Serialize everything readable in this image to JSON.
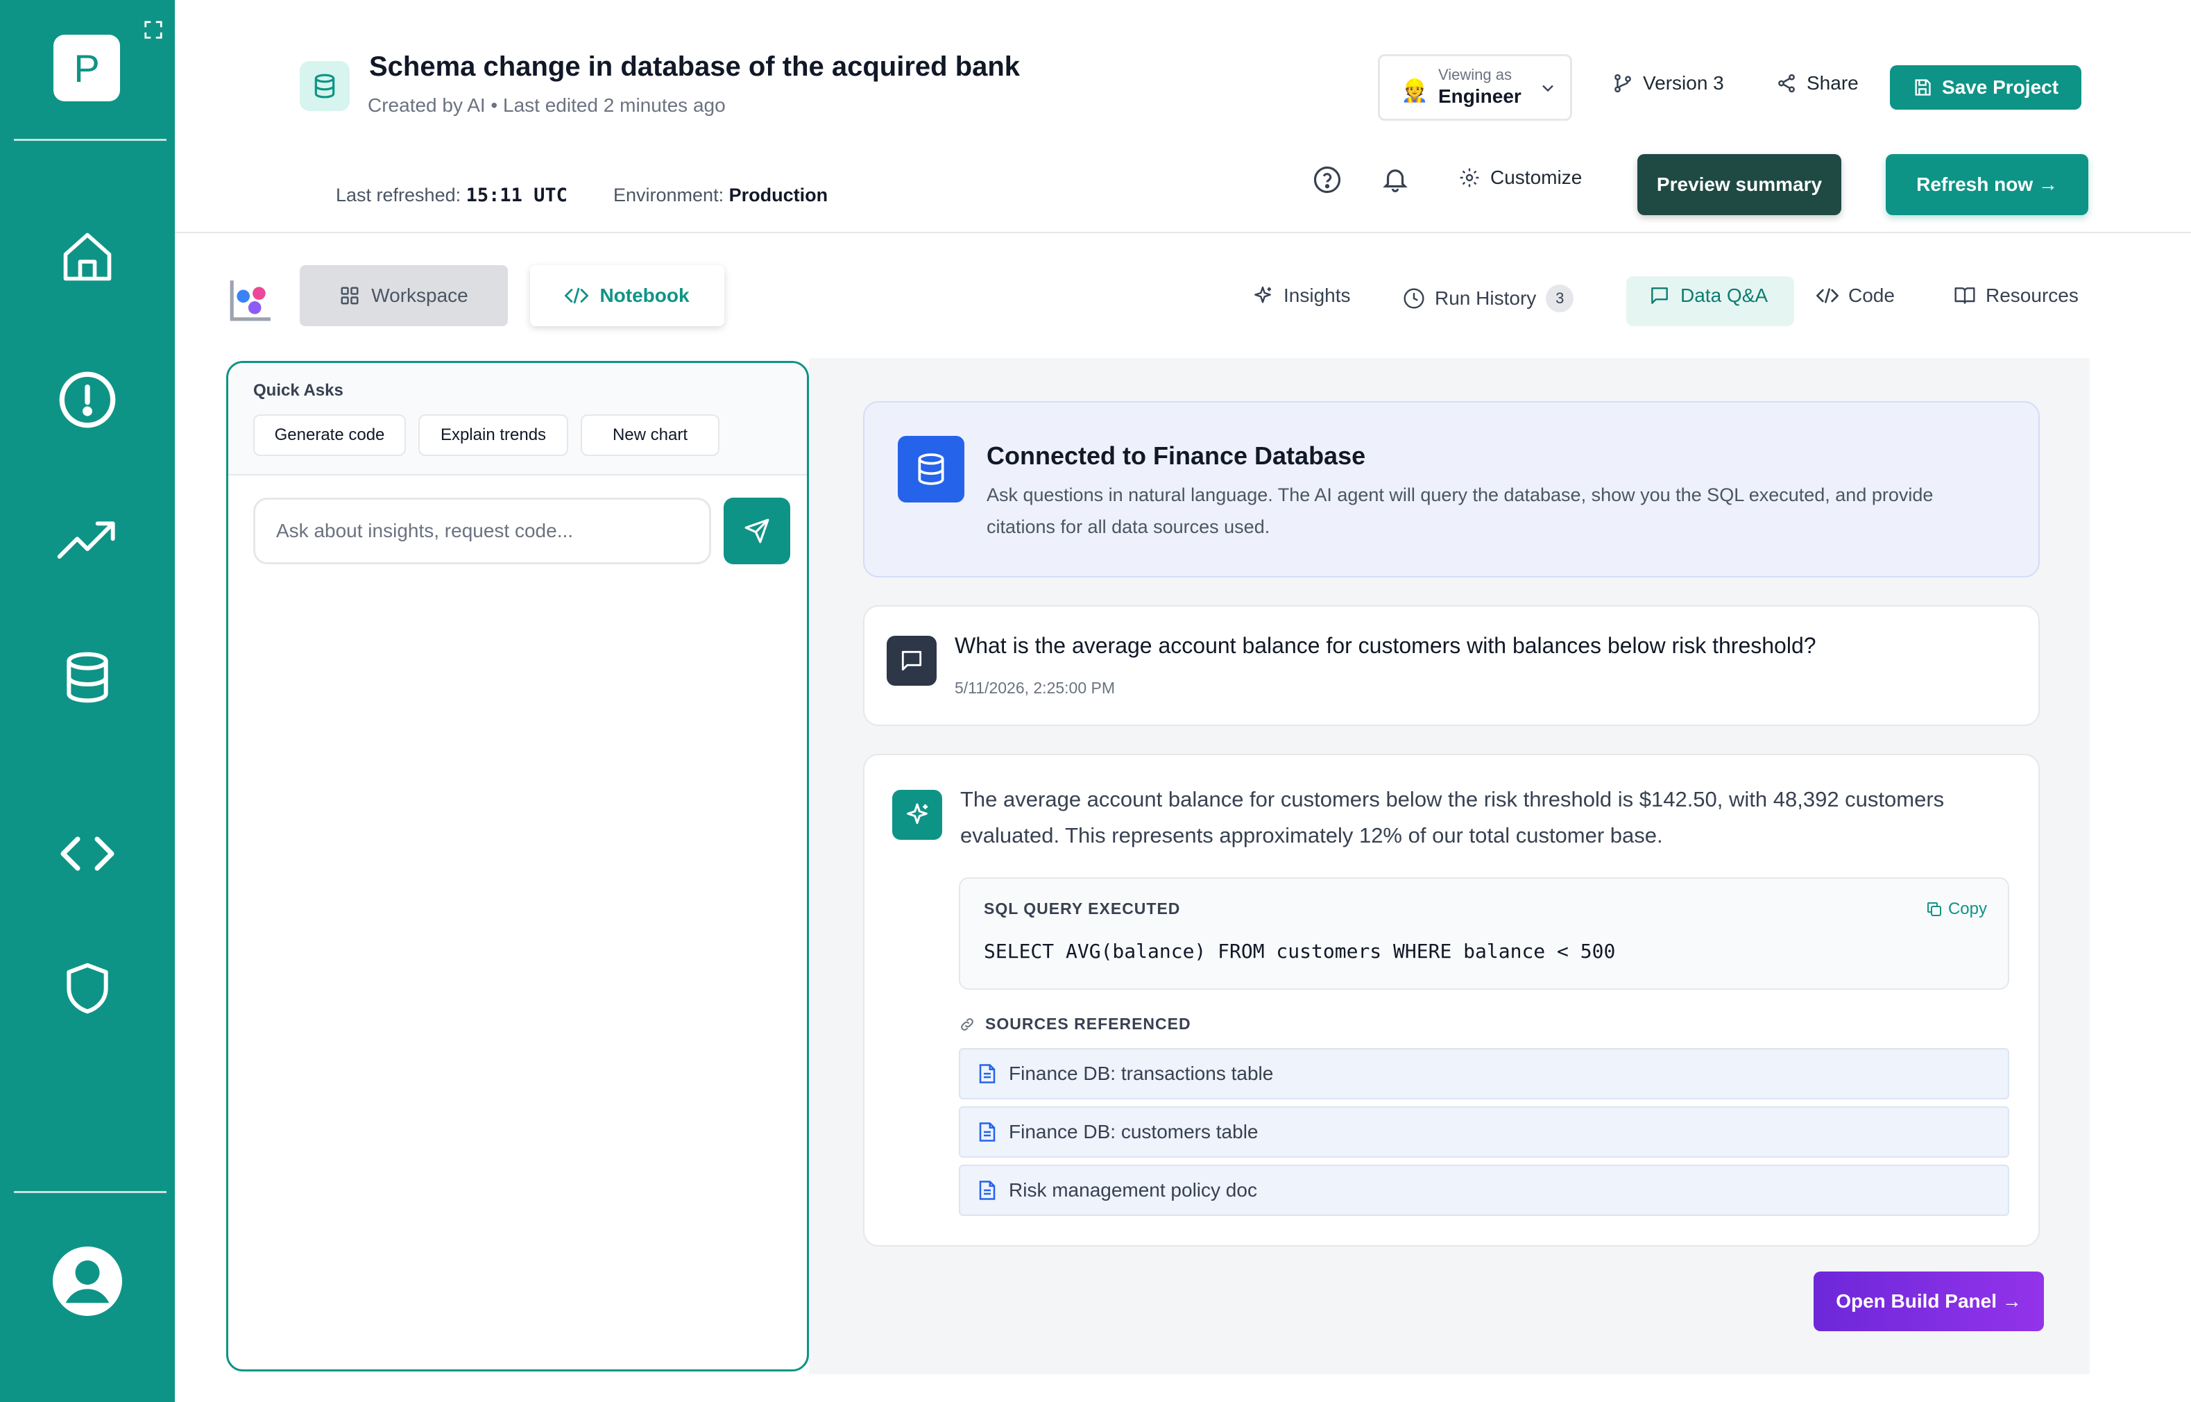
{
  "sidebar": {
    "logo_letter": "P",
    "items": [
      {
        "icon": "home-icon"
      },
      {
        "icon": "alert-icon"
      },
      {
        "icon": "trending-up-icon"
      },
      {
        "icon": "database-icon"
      },
      {
        "icon": "code-icon"
      },
      {
        "icon": "shield-icon"
      }
    ],
    "profile_icon": "user-avatar-icon"
  },
  "header": {
    "title": "Schema change in database of the acquired bank",
    "subtitle": "Created by AI • Last edited 2 minutes ago",
    "last_refreshed_label": "Last refreshed:",
    "last_refreshed_value": "15:11 UTC",
    "environment_label": "Environment:",
    "environment_value": "Production",
    "viewing_as_label": "Viewing as",
    "viewing_as_value": "Engineer",
    "version_label": "Version 3",
    "share_label": "Share",
    "save_label": "Save Project",
    "customize_label": "Customize",
    "preview_label": "Preview summary",
    "refresh_label": "Refresh now →"
  },
  "view_tabs": {
    "workspace": "Workspace",
    "notebook": "Notebook"
  },
  "tabs": [
    {
      "label": "Insights",
      "icon": "sparkle-icon"
    },
    {
      "label": "Run History",
      "icon": "clock-icon",
      "badge": "3"
    },
    {
      "label": "Data Q&A",
      "icon": "chat-icon",
      "active": true
    },
    {
      "label": "Code",
      "icon": "code-icon"
    },
    {
      "label": "Resources",
      "icon": "book-icon"
    }
  ],
  "chat_panel": {
    "quick_asks_title": "Quick Asks",
    "chips": [
      "Generate code",
      "Explain trends",
      "New chart"
    ],
    "input_placeholder": "Ask about insights, request code..."
  },
  "connection": {
    "title": "Connected to Finance Database",
    "description": "Ask questions in natural language. The AI agent will query the database, show you the SQL executed, and provide citations for all data sources used."
  },
  "question": {
    "text": "What is the average account balance for customers with balances below risk threshold?",
    "timestamp": "5/11/2026, 2:25:00 PM"
  },
  "answer": {
    "text": "The average account balance for customers below the risk threshold is $142.50, with 48,392 customers evaluated. This represents approximately 12% of our total customer base.",
    "sql_label": "SQL QUERY EXECUTED",
    "copy_label": "Copy",
    "sql": "SELECT AVG(balance) FROM customers WHERE balance < 500",
    "sources_label": "SOURCES REFERENCED",
    "sources": [
      "Finance DB: transactions table",
      "Finance DB: customers table",
      "Risk management policy doc"
    ]
  },
  "build_button": "Open Build Panel →",
  "colors": {
    "brand": "#0e9486",
    "dark_button": "#1f4a43",
    "db_blue": "#2563eb",
    "build_purple": "#7c3aed"
  }
}
